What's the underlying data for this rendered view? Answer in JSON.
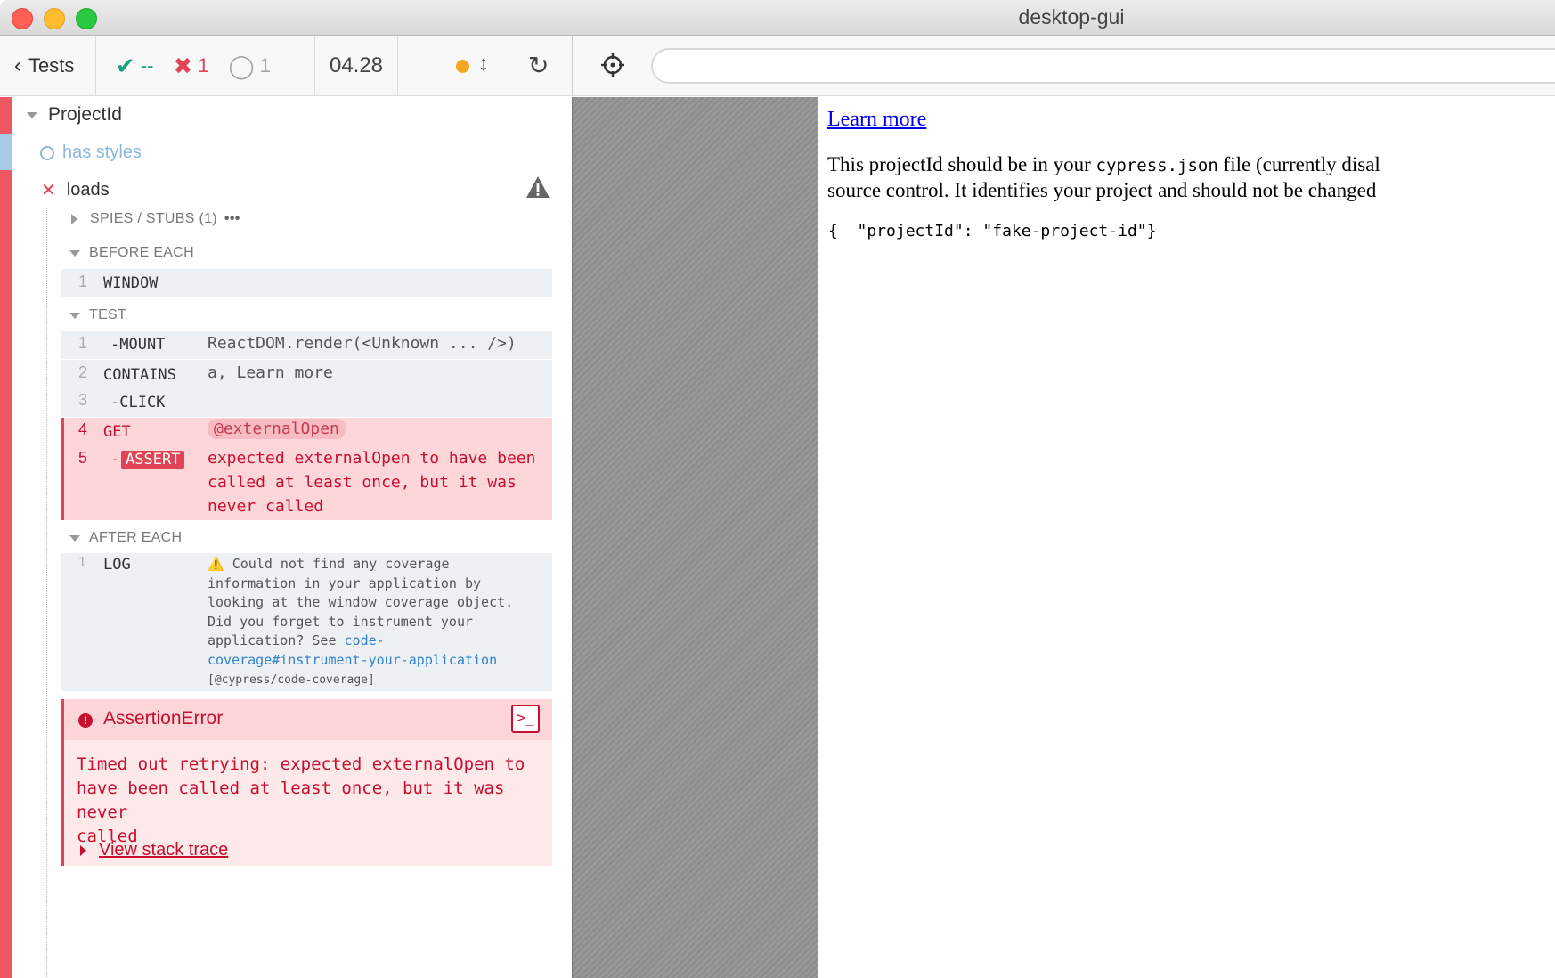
{
  "window": {
    "title": "desktop-gui"
  },
  "header": {
    "tests_label": "Tests",
    "passed": "--",
    "failed": "1",
    "pending": "1",
    "duration": "04.28"
  },
  "suite": {
    "title": "ProjectId",
    "tests": [
      {
        "title": "has styles",
        "state": "pending"
      },
      {
        "title": "loads",
        "state": "failed"
      }
    ]
  },
  "sections": {
    "spies": "SPIES / STUBS (1)",
    "spies_more": "•••",
    "before_each": "BEFORE EACH",
    "test": "TEST",
    "after_each": "AFTER EACH"
  },
  "before_each_cmds": [
    {
      "num": "1",
      "name": "WINDOW",
      "msg": ""
    }
  ],
  "test_cmds": [
    {
      "num": "1",
      "name": "-MOUNT",
      "msg": "ReactDOM.render(<Unknown ... />)"
    },
    {
      "num": "2",
      "name": "CONTAINS",
      "msg": "a, Learn more"
    },
    {
      "num": "3",
      "name": "-CLICK",
      "msg": ""
    },
    {
      "num": "4",
      "name": "GET",
      "msg": "@externalOpen"
    },
    {
      "num": "5",
      "name_prefix": "-",
      "name": "ASSERT",
      "msg_lines": [
        "expected externalOpen to have been",
        "called at least once, but it was",
        "never called"
      ]
    }
  ],
  "after_each_cmds": [
    {
      "num": "1",
      "name": "LOG",
      "warn_icon": "warning-icon",
      "msg_lines": [
        "Could not find any coverage",
        "information in your application by",
        "looking at the window coverage object.",
        "Did you forget to instrument your",
        "application? See"
      ],
      "link_lines": [
        "code-",
        "coverage#instrument-your-application"
      ],
      "tag": "[@cypress/code-coverage]"
    }
  ],
  "error": {
    "title": "AssertionError",
    "message_lines": [
      "Timed out retrying: expected externalOpen to",
      "have been called at least once, but it was never",
      "called"
    ],
    "stack_label": "View stack trace",
    "console_icon": ">_"
  },
  "aut": {
    "link": "Learn more",
    "para_line1_pre": "This projectId should be in your ",
    "para_code": "cypress.json",
    "para_line1_post": " file (currently disal",
    "para_line2": "source control. It identifies your project and should not be changed",
    "code_block": "{  \"projectId\": \"fake-project-id\"}"
  },
  "colors": {
    "fail": "#e04455",
    "pass": "#16a085",
    "pending": "#8cb7dd",
    "error_text": "#c8102e"
  }
}
